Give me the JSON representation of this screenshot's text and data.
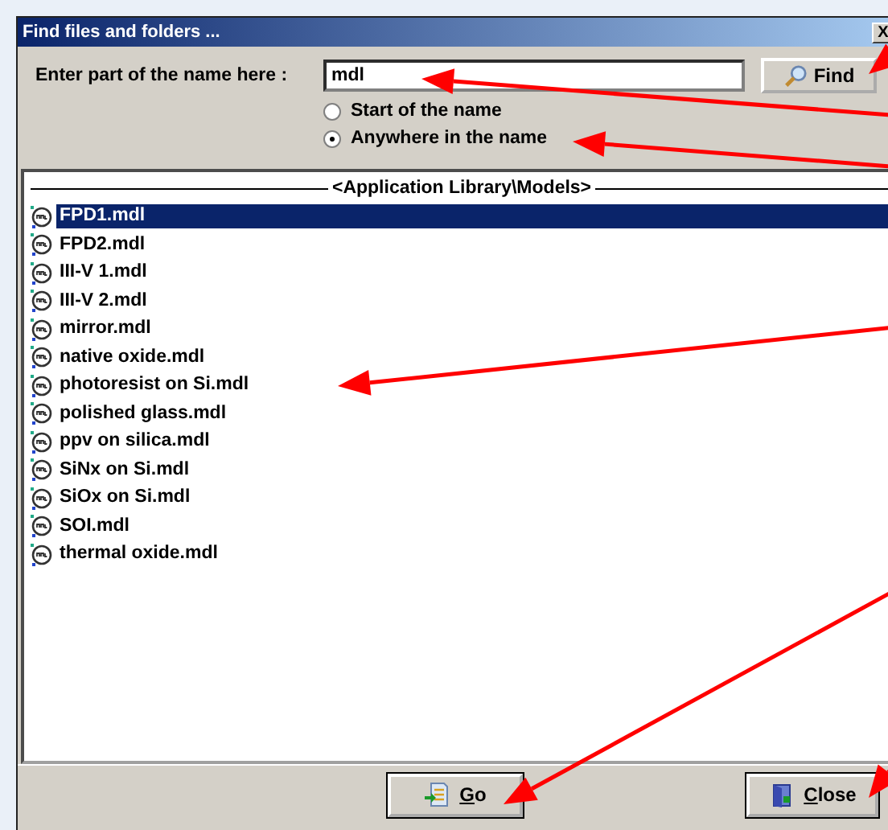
{
  "window": {
    "title": "Find files and folders ...",
    "close_button": "X"
  },
  "search": {
    "label": "Enter part of the name here :",
    "value": "mdl",
    "find_button": "Find"
  },
  "match_options": [
    {
      "label": "Start of the name",
      "selected": false
    },
    {
      "label": "Anywhere in the name",
      "selected": true
    }
  ],
  "list": {
    "header": "<Application Library\\Models>",
    "items": [
      {
        "name": "FPD1.mdl",
        "selected": true
      },
      {
        "name": "FPD2.mdl",
        "selected": false
      },
      {
        "name": "III-V 1.mdl",
        "selected": false
      },
      {
        "name": "III-V 2.mdl",
        "selected": false
      },
      {
        "name": "mirror.mdl",
        "selected": false
      },
      {
        "name": "native oxide.mdl",
        "selected": false
      },
      {
        "name": "photoresist on Si.mdl",
        "selected": false
      },
      {
        "name": "polished glass.mdl",
        "selected": false
      },
      {
        "name": "ppv on silica.mdl",
        "selected": false
      },
      {
        "name": "SiNx on Si.mdl",
        "selected": false
      },
      {
        "name": "SiOx on Si.mdl",
        "selected": false
      },
      {
        "name": "SOI.mdl",
        "selected": false
      },
      {
        "name": "thermal oxide.mdl",
        "selected": false
      }
    ]
  },
  "buttons": [
    {
      "kind": "go",
      "label": "Go"
    },
    {
      "kind": "close",
      "label": "Close"
    }
  ]
}
